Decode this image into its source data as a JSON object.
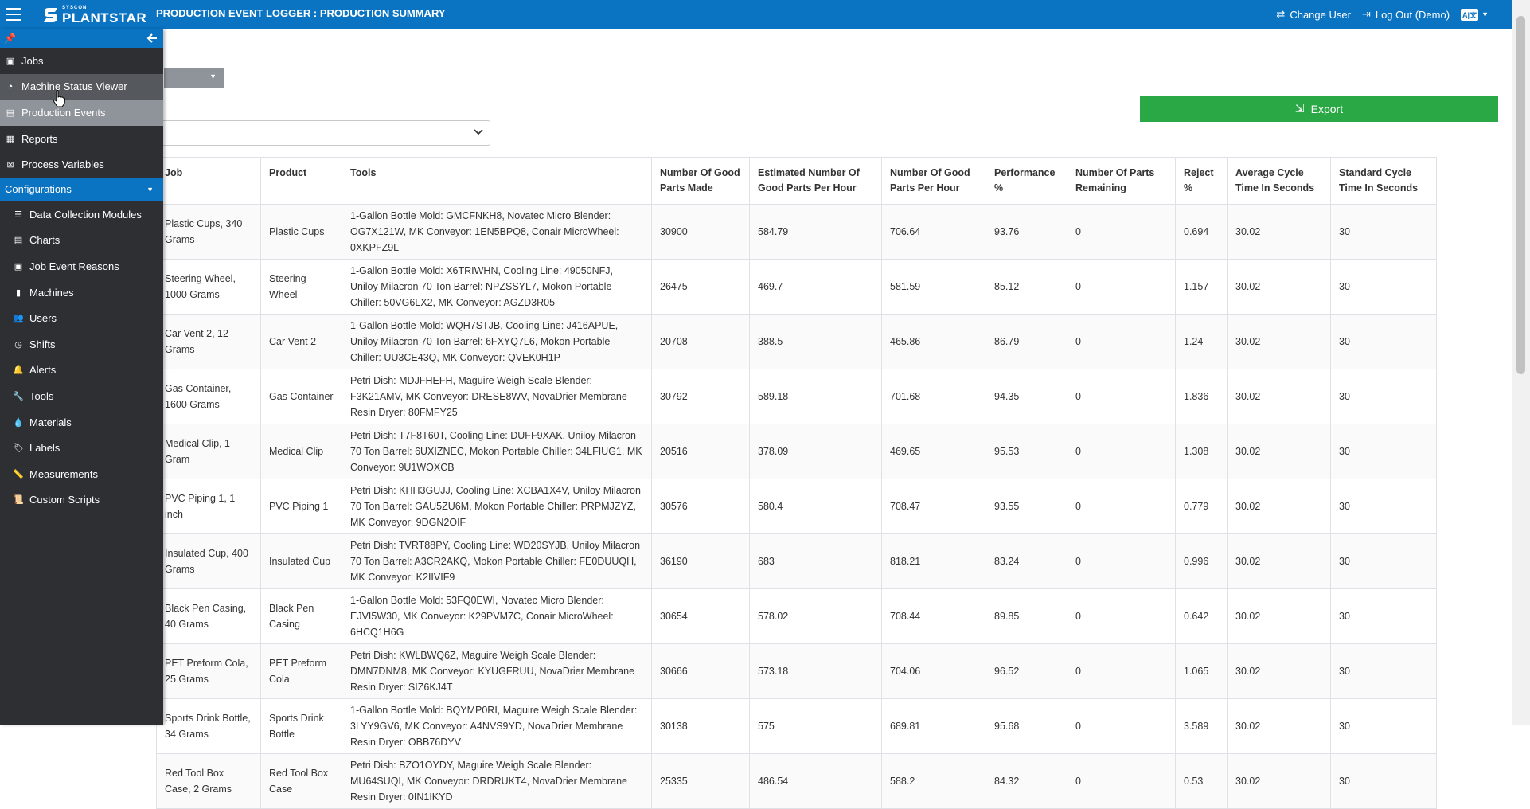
{
  "header": {
    "logo_top": "SYSCON",
    "logo_main": "PLANTSTAR",
    "title": "PRODUCTION EVENT LOGGER : PRODUCTION SUMMARY",
    "change_user": "Change User",
    "logout": "Log Out (Demo)",
    "lang": "A|文"
  },
  "toolbar": {
    "export_label": "Export"
  },
  "sidebar": {
    "items": [
      {
        "label": "Jobs",
        "icon": "briefcase-icon"
      },
      {
        "label": "Machine Status Viewer",
        "icon": "gauge-icon"
      },
      {
        "label": "Production Events",
        "icon": "chart-icon"
      },
      {
        "label": "Reports",
        "icon": "file-icon"
      },
      {
        "label": "Process Variables",
        "icon": "process-icon"
      }
    ],
    "config_label": "Configurations",
    "config_items": [
      {
        "label": "Data Collection Modules",
        "icon": "database-icon"
      },
      {
        "label": "Charts",
        "icon": "chart-list-icon"
      },
      {
        "label": "Job Event Reasons",
        "icon": "reasons-icon"
      },
      {
        "label": "Machines",
        "icon": "machine-icon"
      },
      {
        "label": "Users",
        "icon": "users-icon"
      },
      {
        "label": "Shifts",
        "icon": "clock-icon"
      },
      {
        "label": "Alerts",
        "icon": "bell-icon"
      },
      {
        "label": "Tools",
        "icon": "wrench-icon"
      },
      {
        "label": "Materials",
        "icon": "drop-icon"
      },
      {
        "label": "Labels",
        "icon": "tags-icon"
      },
      {
        "label": "Measurements",
        "icon": "ruler-icon"
      },
      {
        "label": "Custom Scripts",
        "icon": "script-icon"
      }
    ]
  },
  "table": {
    "headers": [
      "Job",
      "Product",
      "Tools",
      "Number Of Good Parts Made",
      "Estimated Number Of Good Parts Per Hour",
      "Number Of Good Parts Per Hour",
      "Performance %",
      "Number Of Parts Remaining",
      "Reject %",
      "Average Cycle Time In Seconds",
      "Standard Cycle Time In Seconds"
    ],
    "rows": [
      [
        "Plastic Cups, 340 Grams",
        "Plastic Cups",
        "1-Gallon Bottle Mold: GMCFNKH8, Novatec Micro Blender: OG7X121W, MK Conveyor: 1EN5BPQ8, Conair MicroWheel: 0XKPFZ9L",
        "30900",
        "584.79",
        "706.64",
        "93.76",
        "0",
        "0.694",
        "30.02",
        "30"
      ],
      [
        "Steering Wheel, 1000 Grams",
        "Steering Wheel",
        "1-Gallon Bottle Mold: X6TRIWHN, Cooling Line: 49050NFJ, Uniloy Milacron 70 Ton Barrel: NPZSSYL7, Mokon Portable Chiller: 50VG6LX2, MK Conveyor: AGZD3R05",
        "26475",
        "469.7",
        "581.59",
        "85.12",
        "0",
        "1.157",
        "30.02",
        "30"
      ],
      [
        "Car Vent 2, 12 Grams",
        "Car Vent 2",
        "1-Gallon Bottle Mold: WQH7STJB, Cooling Line: J416APUE, Uniloy Milacron 70 Ton Barrel: 6FXYQ7L6, Mokon Portable Chiller: UU3CE43Q, MK Conveyor: QVEK0H1P",
        "20708",
        "388.5",
        "465.86",
        "86.79",
        "0",
        "1.24",
        "30.02",
        "30"
      ],
      [
        "Gas Container, 1600 Grams",
        "Gas Container",
        "Petri Dish: MDJFHEFH, Maguire Weigh Scale Blender: F3K21AMV, MK Conveyor: DRESE8WV, NovaDrier Membrane Resin Dryer: 80FMFY25",
        "30792",
        "589.18",
        "701.68",
        "94.35",
        "0",
        "1.836",
        "30.02",
        "30"
      ],
      [
        "Medical Clip, 1 Gram",
        "Medical Clip",
        "Petri Dish: T7F8T60T, Cooling Line: DUFF9XAK, Uniloy Milacron 70 Ton Barrel: 6UXIZNEC, Mokon Portable Chiller: 34LFIUG1, MK Conveyor: 9U1WOXCB",
        "20516",
        "378.09",
        "469.65",
        "95.53",
        "0",
        "1.308",
        "30.02",
        "30"
      ],
      [
        "PVC Piping 1, 1 inch",
        "PVC Piping 1",
        "Petri Dish: KHH3GUJJ, Cooling Line: XCBA1X4V, Uniloy Milacron 70 Ton Barrel: GAU5ZU6M, Mokon Portable Chiller: PRPMJZYZ, MK Conveyor: 9DGN2OIF",
        "30576",
        "580.4",
        "708.47",
        "93.55",
        "0",
        "0.779",
        "30.02",
        "30"
      ],
      [
        "Insulated Cup, 400 Grams",
        "Insulated Cup",
        "Petri Dish: TVRT88PY, Cooling Line: WD20SYJB, Uniloy Milacron 70 Ton Barrel: A3CR2AKQ, Mokon Portable Chiller: FE0DUUQH, MK Conveyor: K2IIVIF9",
        "36190",
        "683",
        "818.21",
        "83.24",
        "0",
        "0.996",
        "30.02",
        "30"
      ],
      [
        "Black Pen Casing, 40 Grams",
        "Black Pen Casing",
        "1-Gallon Bottle Mold: 53FQ0EWI, Novatec Micro Blender: EJVI5W30, MK Conveyor: K29PVM7C, Conair MicroWheel: 6HCQ1H6G",
        "30654",
        "578.02",
        "708.44",
        "89.85",
        "0",
        "0.642",
        "30.02",
        "30"
      ],
      [
        "PET Preform Cola, 25 Grams",
        "PET Preform Cola",
        "Petri Dish: KWLBWQ6Z, Maguire Weigh Scale Blender: DMN7DNM8, MK Conveyor: KYUGFRUU, NovaDrier Membrane Resin Dryer: SIZ6KJ4T",
        "30666",
        "573.18",
        "704.06",
        "96.52",
        "0",
        "1.065",
        "30.02",
        "30"
      ],
      [
        "Sports Drink Bottle, 34 Grams",
        "Sports Drink Bottle",
        "1-Gallon Bottle Mold: BQYMP0RI, Maguire Weigh Scale Blender: 3LYY9GV6, MK Conveyor: A4NVS9YD, NovaDrier Membrane Resin Dryer: OBB76DYV",
        "30138",
        "575",
        "689.81",
        "95.68",
        "0",
        "3.589",
        "30.02",
        "30"
      ],
      [
        "Red Tool Box Case, 2 Grams",
        "Red Tool Box Case",
        "Petri Dish: BZO1OYDY, Maguire Weigh Scale Blender: MU64SUQI, MK Conveyor: DRDRUKT4, NovaDrier Membrane Resin Dryer: 0IN1IKYD",
        "25335",
        "486.54",
        "588.2",
        "84.32",
        "0",
        "0.53",
        "30.02",
        "30"
      ]
    ]
  }
}
